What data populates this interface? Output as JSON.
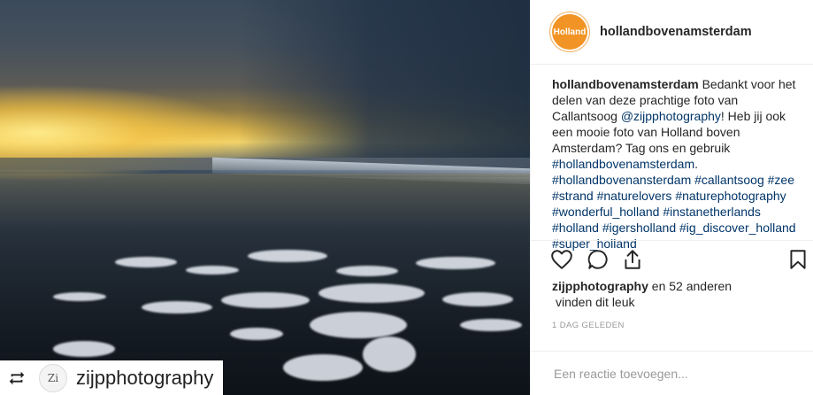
{
  "post": {
    "account": "hollandbovenamsterdam",
    "avatar_text": "Holland",
    "caption": {
      "author": "hollandbovenamsterdam",
      "text_1": "Bedankt voor het delen van deze prachtige foto van Callantsoog",
      "mention": "@zijpphotography",
      "text_2": "! Heb jij ook een mooie foto van Holland boven Amsterdam? Tag ons en gebruik",
      "hashtags": [
        "#hollandbovenamsterdam",
        "#hollandbovenansterdam",
        "#callantsoog",
        "#zee",
        "#strand",
        "#naturelovers",
        "#naturephotography",
        "#wonderful_holland",
        "#instanetherlands",
        "#holland",
        "#igersholland",
        "#ig_discover_holland",
        "#super_holland"
      ]
    },
    "likes": {
      "liker": "zijpphotography",
      "others": "en 52 anderen",
      "suffix": "vinden dit leuk"
    },
    "timestamp": "1 DAG GELEDEN",
    "comment_placeholder": "Een reactie toevoegen...",
    "icons": {
      "like": "heart-icon",
      "comment": "comment-bubble-icon",
      "share": "share-icon",
      "save": "bookmark-icon",
      "repost": "repost-icon"
    }
  },
  "repost_badge": {
    "name": "zijpphotography",
    "avatar_text": "Zi"
  },
  "colors": {
    "avatar_bg": "#f29425",
    "hashtag": "#003569",
    "text": "#262626",
    "muted": "#999999"
  }
}
